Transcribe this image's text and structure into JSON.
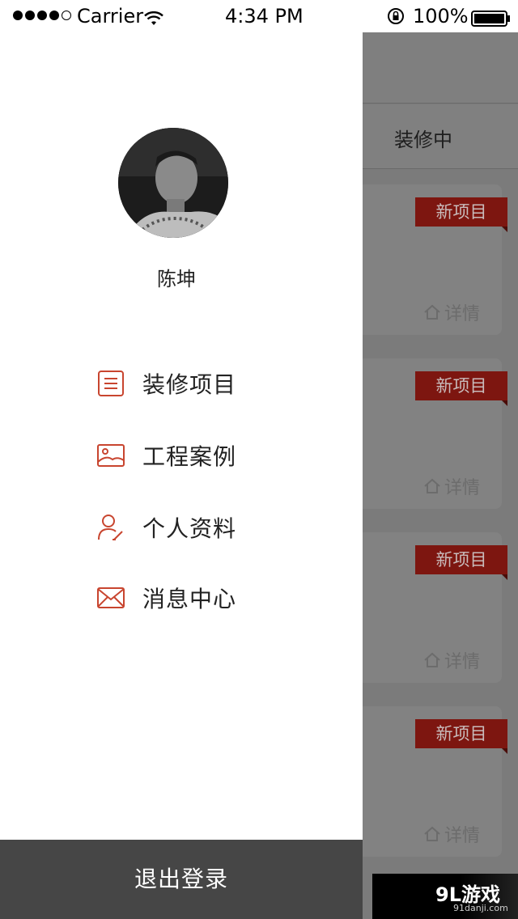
{
  "status_bar": {
    "carrier": "Carrier",
    "time": "4:34 PM",
    "battery": "100%"
  },
  "drawer": {
    "user_name": "陈坤",
    "menu": [
      {
        "label": "装修项目",
        "icon": "list-document-icon"
      },
      {
        "label": "工程案例",
        "icon": "image-icon"
      },
      {
        "label": "个人资料",
        "icon": "user-edit-icon"
      },
      {
        "label": "消息中心",
        "icon": "mail-icon"
      }
    ],
    "logout_label": "退出登录"
  },
  "background": {
    "tab_label": "装修中",
    "cards": [
      {
        "tag": "新项目",
        "detail": "详情"
      },
      {
        "tag": "新项目",
        "detail": "详情"
      },
      {
        "tag": "新项目",
        "detail": "详情"
      },
      {
        "tag": "新项目",
        "detail": "详情"
      }
    ],
    "watermark": {
      "logo": "9L游戏",
      "url": "91danji.com"
    }
  },
  "colors": {
    "accent": "#c8452f",
    "tag_bg": "#7d1610",
    "logout_bg": "#464646",
    "overlay": "#7b7b7b"
  }
}
